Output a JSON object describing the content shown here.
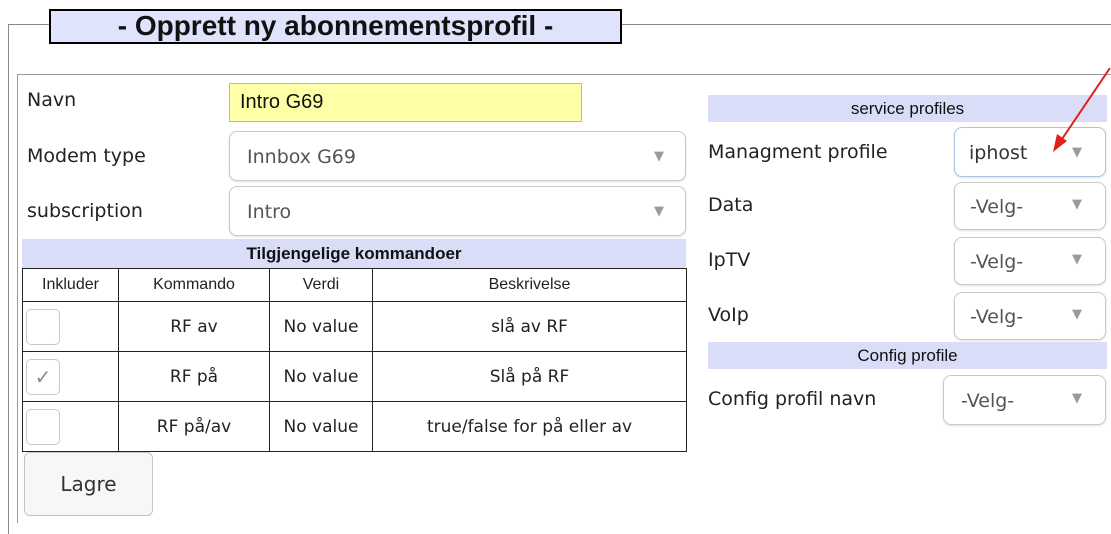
{
  "title": "- Opprett ny abonnementsprofil -",
  "form": {
    "name_label": "Navn",
    "name_value": "Intro G69",
    "modem_label": "Modem type",
    "modem_value": "Innbox G69",
    "subscription_label": "subscription",
    "subscription_value": "Intro"
  },
  "commands": {
    "heading": "Tilgjengelige kommandoer",
    "columns": [
      "Inkluder",
      "Kommando",
      "Verdi",
      "Beskrivelse"
    ],
    "rows": [
      {
        "checked": false,
        "check_mark": "",
        "command": "RF av",
        "value": "No value",
        "description": "slå av RF"
      },
      {
        "checked": true,
        "check_mark": "✓",
        "command": "RF på",
        "value": "No value",
        "description": "Slå på RF"
      },
      {
        "checked": false,
        "check_mark": "",
        "command": "RF på/av",
        "value": "No value",
        "description": "true/false for på eller av"
      }
    ]
  },
  "save_label": "Lagre",
  "service_profiles": {
    "heading": "service profiles",
    "management_label": "Managment profile",
    "management_value": "iphost",
    "data_label": "Data",
    "data_value": "-Velg-",
    "iptv_label": "IpTV",
    "iptv_value": "-Velg-",
    "voip_label": "VoIp",
    "voip_value": "-Velg-"
  },
  "config_profile": {
    "heading": "Config profile",
    "name_label": "Config profil navn",
    "name_value": "-Velg-"
  },
  "dropdown_arrow": "▼",
  "colors": {
    "header_bg": "#dfe3fb",
    "section_bg": "#d9ddf8",
    "input_highlight": "#ffffa8",
    "annotation_arrow": "#e0201a"
  }
}
